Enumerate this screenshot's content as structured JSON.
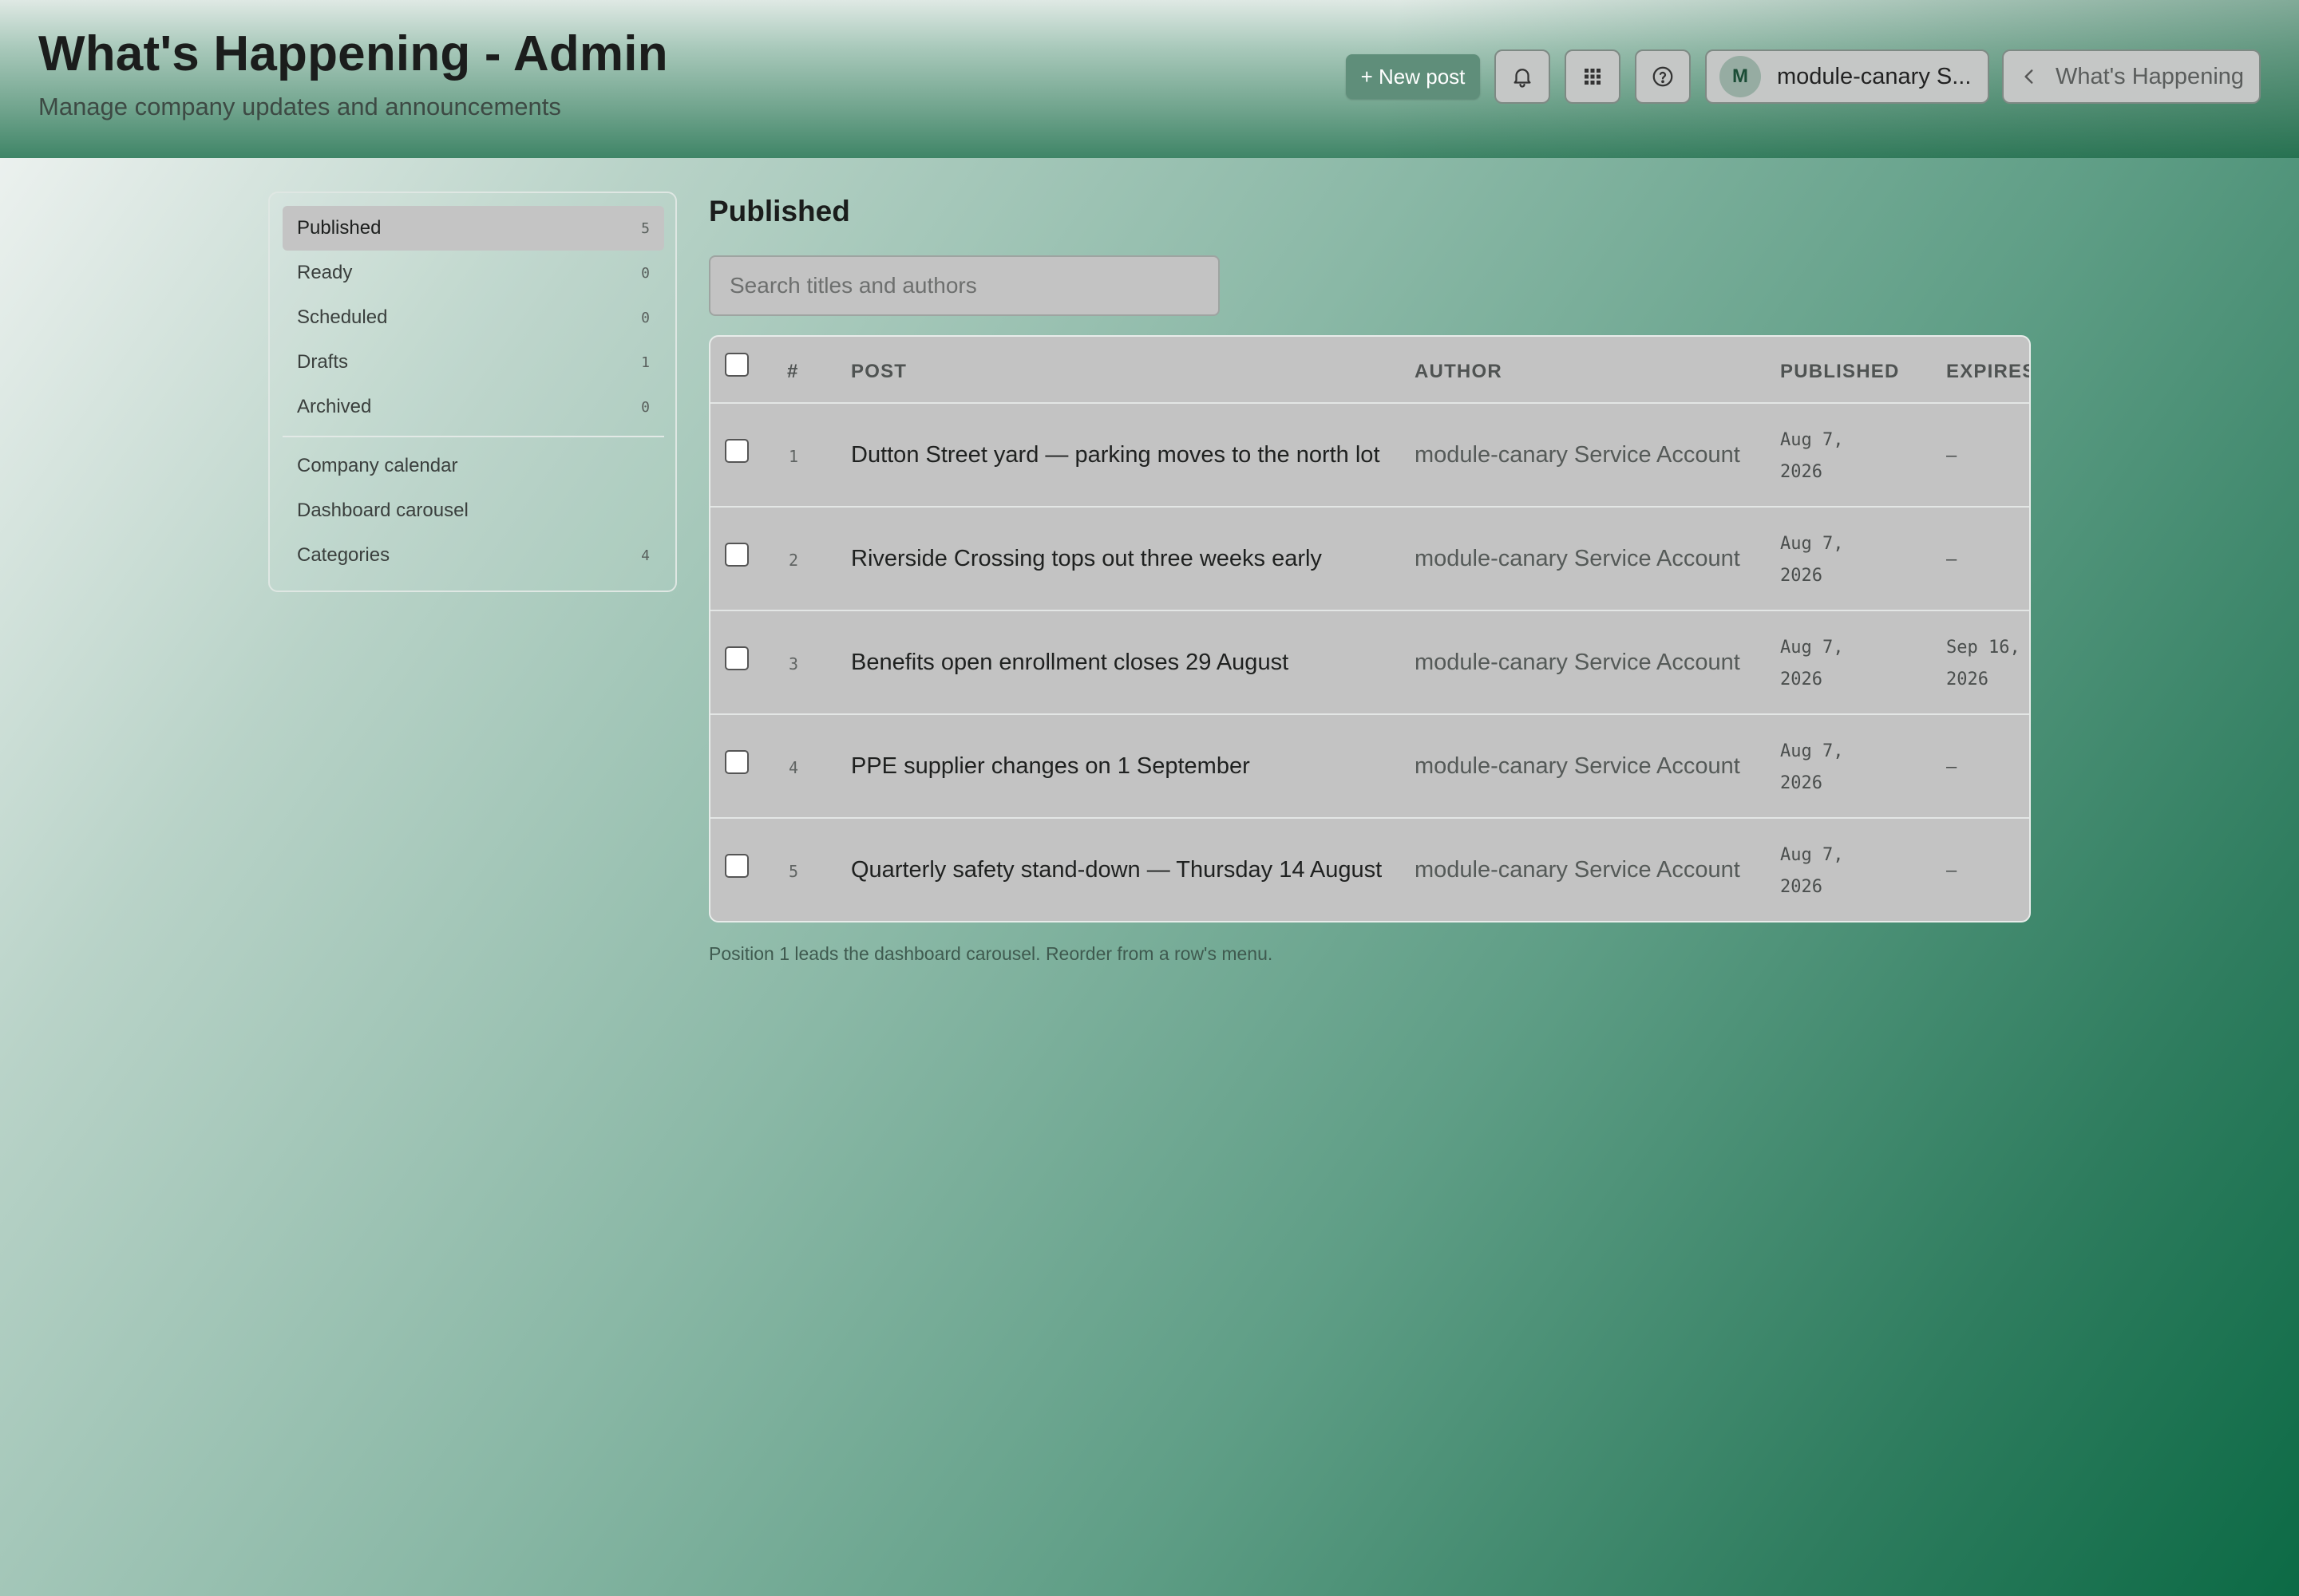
{
  "header": {
    "title": "What's Happening - Admin",
    "subtitle": "Manage company updates and announcements",
    "new_post_label": "+ New post",
    "user_initial": "M",
    "user_name": "module-canary S...",
    "back_label": "What's Happening",
    "icons": [
      "bell-icon",
      "grid-icon",
      "help-icon",
      "chevron-left-icon"
    ]
  },
  "sidebar": {
    "items": [
      {
        "label": "Published",
        "count": "5"
      },
      {
        "label": "Ready",
        "count": "0"
      },
      {
        "label": "Scheduled",
        "count": "0"
      },
      {
        "label": "Drafts",
        "count": "1"
      },
      {
        "label": "Archived",
        "count": "0"
      }
    ],
    "links": [
      {
        "label": "Company calendar",
        "count": ""
      },
      {
        "label": "Dashboard carousel",
        "count": ""
      },
      {
        "label": "Categories",
        "count": "4"
      }
    ]
  },
  "main": {
    "title": "Published",
    "search_placeholder": "Search titles and authors",
    "columns": {
      "num": "#",
      "post": "POST",
      "author": "AUTHOR",
      "published": "PUBLISHED",
      "expires": "EXPIRES"
    },
    "rows": [
      {
        "num": "1",
        "post": "Dutton Street yard — parking moves to the north lot",
        "author": "module-canary Service Account",
        "published_1": "Aug 7,",
        "published_2": "2026",
        "expires_1": "–",
        "expires_2": ""
      },
      {
        "num": "2",
        "post": "Riverside Crossing tops out three weeks early",
        "author": "module-canary Service Account",
        "published_1": "Aug 7,",
        "published_2": "2026",
        "expires_1": "–",
        "expires_2": ""
      },
      {
        "num": "3",
        "post": "Benefits open enrollment closes 29 August",
        "author": "module-canary Service Account",
        "published_1": "Aug 7,",
        "published_2": "2026",
        "expires_1": "Sep 16,",
        "expires_2": "2026"
      },
      {
        "num": "4",
        "post": "PPE supplier changes on 1 September",
        "author": "module-canary Service Account",
        "published_1": "Aug 7,",
        "published_2": "2026",
        "expires_1": "–",
        "expires_2": ""
      },
      {
        "num": "5",
        "post": "Quarterly safety stand-down — Thursday 14 August",
        "author": "module-canary Service Account",
        "published_1": "Aug 7,",
        "published_2": "2026",
        "expires_1": "–",
        "expires_2": ""
      }
    ],
    "footnote": "Position 1 leads the dashboard carousel. Reorder from a row's menu."
  }
}
